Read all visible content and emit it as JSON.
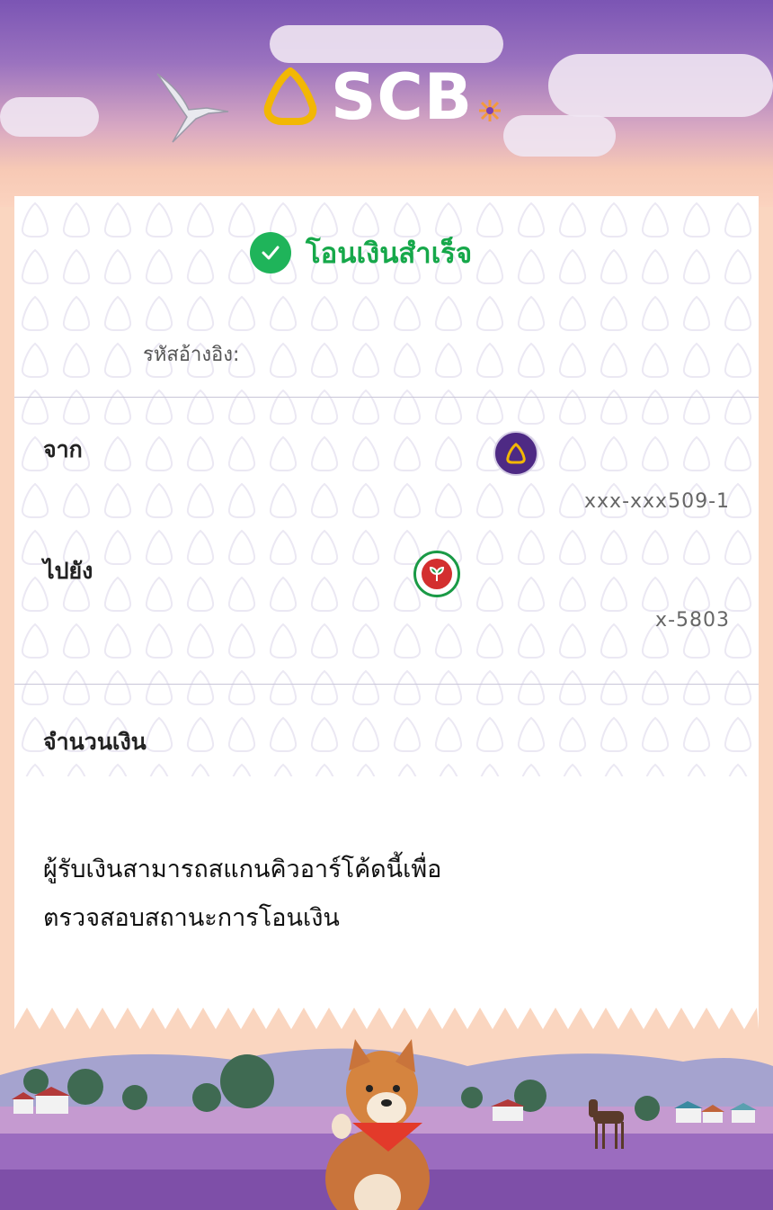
{
  "header": {
    "brand": "SCB",
    "colors": {
      "brand_purple": "#4e2a84",
      "brand_gold": "#f2b705"
    }
  },
  "receipt": {
    "status": "โอนเงินสำเร็จ",
    "status_icon": "check-circle-icon",
    "status_color": "#1fb45a",
    "reference_label": "รหัสอ้างอิง:",
    "reference_value": "",
    "from": {
      "label": "จาก",
      "bank_icon": "scb-bank-icon",
      "account": "xxx-xxx509-1"
    },
    "to": {
      "label": "ไปยัง",
      "bank_icon": "kbank-bank-icon",
      "account": "x-5803"
    },
    "amount_label": "จำนวนเงิน",
    "amount_value": "",
    "qr_note_line1": "ผู้รับเงินสามารถสแกนคิวอาร์โค้ดนี้เพื่อ",
    "qr_note_line2": "ตรวจสอบสถานะการโอนเงิน"
  }
}
